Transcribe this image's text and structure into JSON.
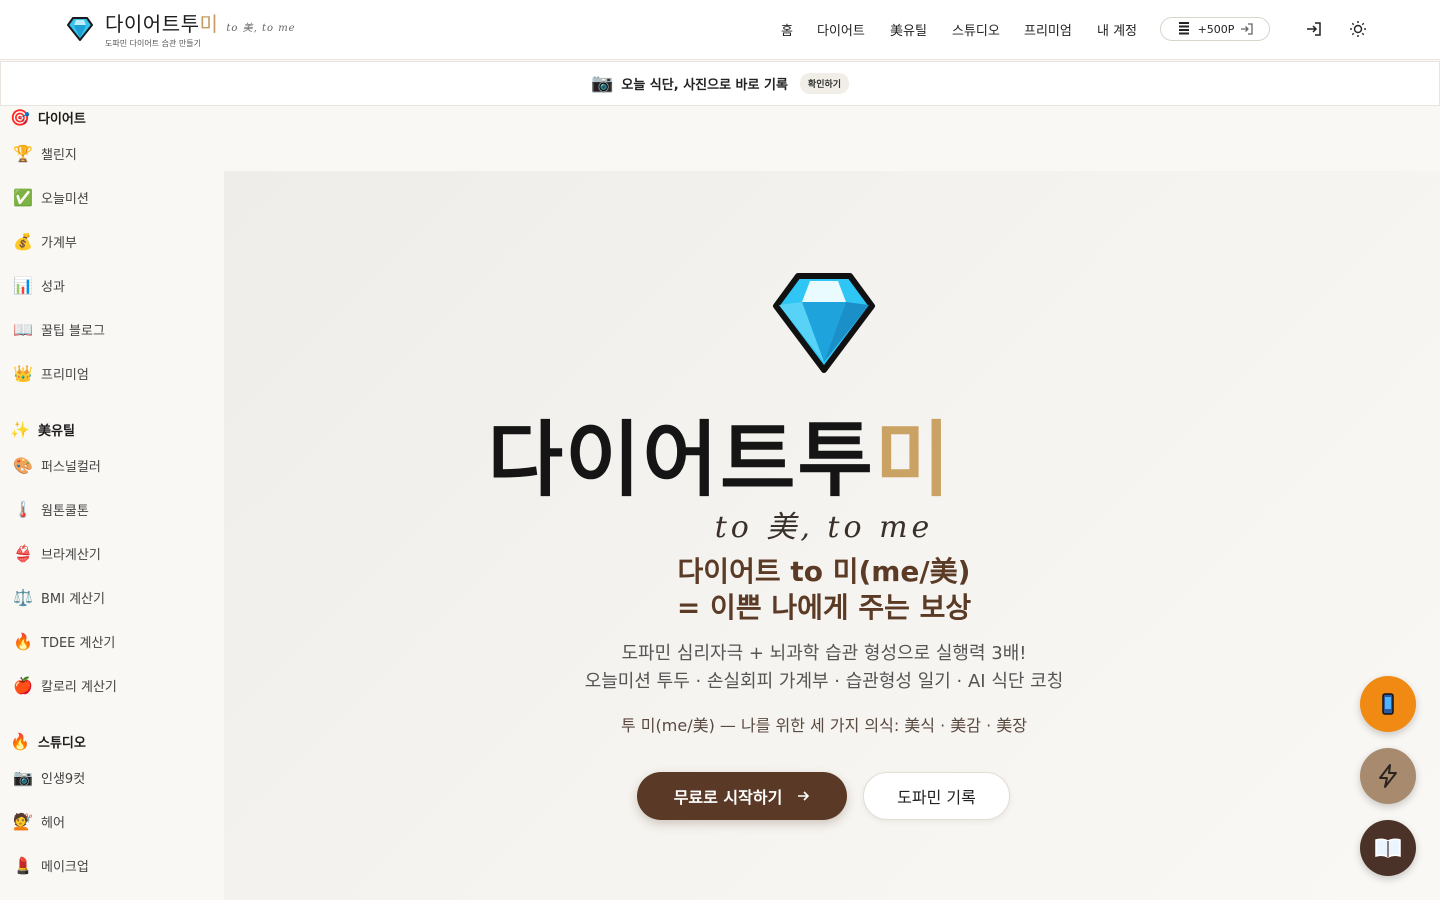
{
  "header": {
    "brand_name": "다이어트투",
    "brand_name_mi": "미",
    "brand_slogan": "to 美, to me",
    "brand_subtitle": "도파민 다이어트 습관 만들기",
    "nav": [
      "홈",
      "다이어트",
      "美유틸",
      "스튜디오",
      "프리미엄",
      "내 계정"
    ],
    "points_label": "+500P",
    "icons": [
      "gem-icon",
      "coin-stack-icon",
      "login-icon",
      "sun-icon"
    ]
  },
  "banner": {
    "icon": "camera-icon",
    "text": "오늘 식단, 사진으로 바로 기록",
    "action": "확인하기"
  },
  "sidebar": {
    "sections": [
      {
        "title": "다이어트",
        "icon": "target-icon",
        "emoji": "🎯",
        "items": [
          {
            "label": "챌린지",
            "emoji": "🏆"
          },
          {
            "label": "오늘미션",
            "emoji": "✅"
          },
          {
            "label": "가계부",
            "emoji": "💰"
          },
          {
            "label": "성과",
            "emoji": "📊"
          },
          {
            "label": "꿀팁 블로그",
            "emoji": "📖"
          },
          {
            "label": "프리미엄",
            "emoji": "👑"
          }
        ]
      },
      {
        "title": "美유틸",
        "icon": "sparkle-icon",
        "emoji": "✨",
        "items": [
          {
            "label": "퍼스널컬러",
            "emoji": "🎨"
          },
          {
            "label": "웜톤쿨톤",
            "emoji": "🌡️"
          },
          {
            "label": "브라계산기",
            "emoji": "👙"
          },
          {
            "label": "BMI 계산기",
            "emoji": "⚖️"
          },
          {
            "label": "TDEE 계산기",
            "emoji": "🔥"
          },
          {
            "label": "칼로리 계산기",
            "emoji": "🍎"
          }
        ]
      },
      {
        "title": "스튜디오",
        "icon": "fire-icon",
        "emoji": "🔥",
        "items": [
          {
            "label": "인생9컷",
            "emoji": "📷"
          },
          {
            "label": "헤어",
            "emoji": "💇"
          },
          {
            "label": "메이크업",
            "emoji": "💄"
          }
        ]
      }
    ]
  },
  "hero": {
    "title": "다이어트투",
    "title_mi": "미",
    "slogan": "to 美, to me",
    "headline_1": "다이어트 to 미(me/美)",
    "headline_2": "= 이쁜 나에게 주는 보상",
    "desc_1": "도파민 심리자극 + 뇌과학 습관 형성으로 실행력 3배!",
    "desc_2": "오늘미션 투두 · 손실회피 가계부 · 습관형성 일기 · AI 식단 코칭",
    "tagline": "투 미(me/美) — 나를 위한 세 가지 의식: 美식 · 美감 · 美장",
    "cta_primary": "무료로 시작하기",
    "cta_secondary": "도파민 기록"
  },
  "fabs": [
    "phone-icon",
    "lightning-icon",
    "book-icon"
  ],
  "colors": {
    "accent_gold": "#c9a264",
    "brown": "#5a3a26",
    "orange": "#f08a12",
    "background": "#faf8f4"
  }
}
